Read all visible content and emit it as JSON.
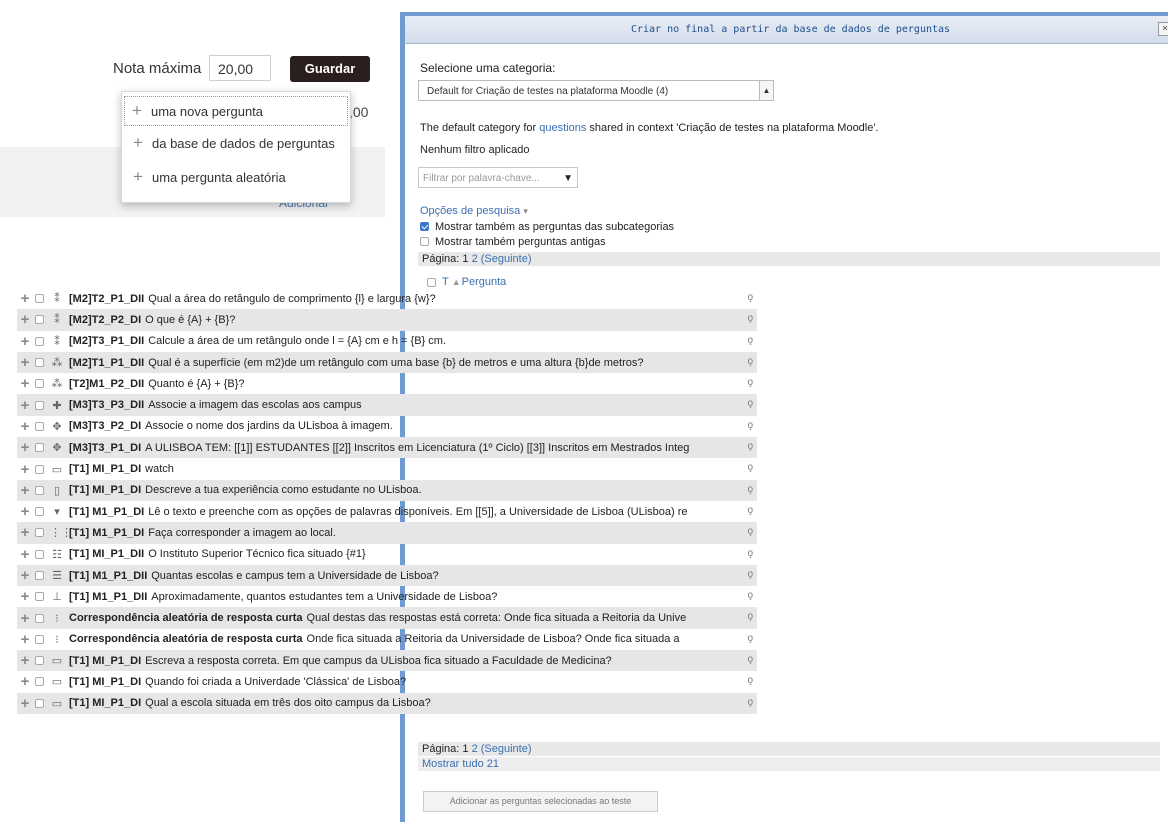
{
  "left": {
    "grade_label": "Nota máxima",
    "grade_value": "20,00",
    "save_label": "Guardar",
    "partial_total": ",00",
    "add_link": "Adicionar",
    "add_menu": [
      {
        "label": "uma nova pergunta"
      },
      {
        "label": "da base de dados de perguntas"
      },
      {
        "label": "uma pergunta aleatória"
      }
    ]
  },
  "dialog": {
    "title": "Criar no final a partir da base de dados de perguntas",
    "close": "×",
    "select_category_label": "Selecione uma categoria:",
    "category_value": "Default for Criação de testes na plataforma Moodle (4)",
    "desc_prefix": "The default category for ",
    "desc_link": "questions",
    "desc_suffix": " shared in context 'Criação de testes na plataforma Moodle'.",
    "no_filter": "Nenhum filtro aplicado",
    "filter_placeholder": "Filtrar por palavra-chave...",
    "search_options": "Opções de pesquisa",
    "opt_subcategories": "Mostrar também as perguntas das subcategorias",
    "opt_old": "Mostrar também perguntas antigas",
    "page_label": "Página:",
    "page_1": "1",
    "page_2": "2",
    "next": "(Seguinte)",
    "col_t": "T",
    "col_question": "Pergunta",
    "show_all": "Mostrar tudo 21",
    "add_selected": "Adicionar as perguntas selecionadas ao teste"
  },
  "questions": [
    {
      "icon": "⁑",
      "name": "[M2]T2_P1_DII",
      "text": "Qual a área do retângulo de comprimento {l} e largura {w}?",
      "shade": false
    },
    {
      "icon": "⁑",
      "name": "[M2]T2_P2_DI",
      "text": "O que é {A} + {B}?",
      "shade": true
    },
    {
      "icon": "⁑",
      "name": "[M2]T3_P1_DII",
      "text": "Calcule a área de um retângulo onde l = {A} cm e h = {B} cm.",
      "shade": false
    },
    {
      "icon": "⁂",
      "name": "[M2]T1_P1_DII",
      "text": "Qual é a superfície (em m2)de um retângulo com uma base {b} de metros e uma altura {b}de metros?",
      "shade": true
    },
    {
      "icon": "⁂",
      "name": "[T2]M1_P2_DII",
      "text": "Quanto é {A} + {B}?",
      "shade": false
    },
    {
      "icon": "✚",
      "name": "[M3]T3_P3_DII",
      "text": "Associe a imagem das escolas aos campus",
      "shade": true
    },
    {
      "icon": "✥",
      "name": "[M3]T3_P2_DI",
      "text": "Associe o nome dos jardins da ULisboa à imagem.",
      "shade": false
    },
    {
      "icon": "✥",
      "name": "[M3]T3_P1_DI",
      "text": "A ULISBOA TEM: [[1]] ESTUDANTES [[2]] Inscritos em Licenciatura (1º Ciclo) [[3]] Inscritos em Mestrados Integ",
      "shade": true
    },
    {
      "icon": "▭",
      "name": "[T1] MI_P1_DI",
      "text": "watch",
      "shade": false
    },
    {
      "icon": "▯",
      "name": "[T1] MI_P1_DI",
      "text": "Descreve a tua experiência como estudante no ULisboa.",
      "shade": true
    },
    {
      "icon": "▾",
      "name": "[T1] M1_P1_DI",
      "text": "Lê o texto e preenche com as opções de palavras disponíveis. Em [[5]], a Universidade de Lisboa (ULisboa) re",
      "shade": false
    },
    {
      "icon": "⋮⋮",
      "name": "[T1] M1_P1_DI",
      "text": "Faça corresponder a imagem ao local.",
      "shade": true
    },
    {
      "icon": "☷",
      "name": "[T1] MI_P1_DII",
      "text": "O Instituto Superior Técnico fica situado {#1}",
      "shade": false
    },
    {
      "icon": "☰",
      "name": "[T1] M1_P1_DII",
      "text": "Quantas escolas e campus tem a Universidade de Lisboa?",
      "shade": true
    },
    {
      "icon": "⊥",
      "name": "[T1] M1_P1_DII",
      "text": "Aproximadamente, quantos estudantes tem a Universidade de Lisboa?",
      "shade": false
    },
    {
      "icon": "⁝",
      "name": "Correspondência aleatória de resposta curta",
      "text": "Qual destas das respostas está correta: Onde fica situada a Reitoria da Unive",
      "shade": true
    },
    {
      "icon": "⁝",
      "name": "Correspondência aleatória de resposta curta",
      "text": "Onde fica situada a Reitoria da Universidade de Lisboa? Onde fica situada a",
      "shade": false
    },
    {
      "icon": "▭",
      "name": "[T1] MI_P1_DI",
      "text": "Escreva a resposta correta. Em que campus da ULisboa fica situado a Faculdade de Medicina?",
      "shade": true
    },
    {
      "icon": "▭",
      "name": "[T1] MI_P1_DI",
      "text": "Quando foi criada a Univerdade 'Clássica' de Lisboa?",
      "shade": false
    },
    {
      "icon": "▭",
      "name": "[T1] MI_P1_DI",
      "text": "Qual a escola situada em três dos oito campus da Lisboa?",
      "shade": true
    }
  ],
  "icons": {
    "add": "plus-icon",
    "preview": "magnifier-icon"
  },
  "colors": {
    "accent": "#3a6fb0",
    "dialog_border": "#6f9bd1",
    "save_button": "#2b1e1e"
  }
}
